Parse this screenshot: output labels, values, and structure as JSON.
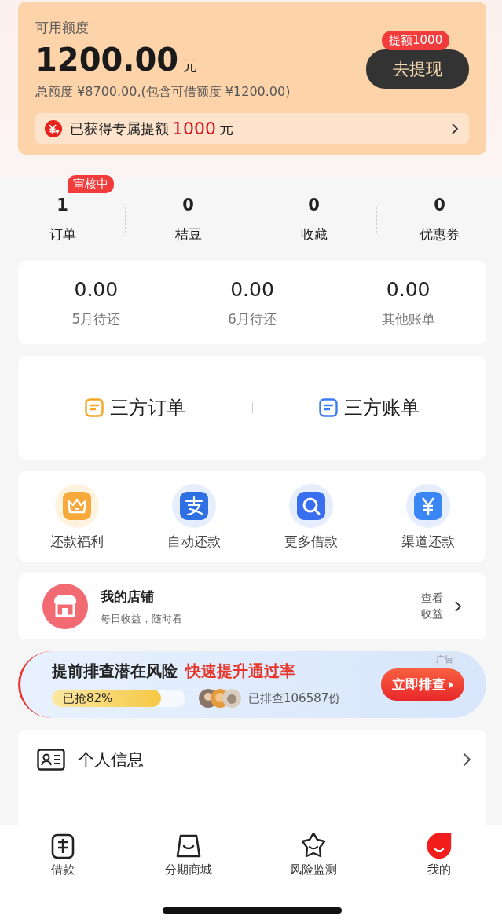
{
  "credit": {
    "label": "可用额度",
    "amount": "1200.00",
    "unit": "元",
    "total": "总额度 ¥8700.00,(包含可借额度 ¥1200.00)",
    "badge": "提额1000",
    "button": "去提现",
    "bonus": {
      "text": "已获得专属提额",
      "amount": "1000",
      "unit": "元"
    }
  },
  "stats": [
    {
      "value": "1",
      "label": "订单",
      "badge": "审核中"
    },
    {
      "value": "0",
      "label": "桔豆"
    },
    {
      "value": "0",
      "label": "收藏"
    },
    {
      "value": "0",
      "label": "优惠券"
    }
  ],
  "bills": [
    {
      "amount": "0.00",
      "label": "5月待还"
    },
    {
      "amount": "0.00",
      "label": "6月待还"
    },
    {
      "amount": "0.00",
      "label": "其他账单"
    }
  ],
  "third_party": [
    {
      "label": "三方订单",
      "color": "#f5a623"
    },
    {
      "label": "三方账单",
      "color": "#3d7bf5"
    }
  ],
  "services": [
    {
      "label": "还款福利",
      "kind": "crown"
    },
    {
      "label": "自动还款",
      "kind": "alipay"
    },
    {
      "label": "更多借款",
      "kind": "search"
    },
    {
      "label": "渠道还款",
      "kind": "yuan"
    }
  ],
  "shop": {
    "title": "我的店铺",
    "subtitle": "每日收益，随时看",
    "action": "查看收益"
  },
  "banner": {
    "title": "提前排查潜在风险",
    "highlight": "快速提升通过率",
    "ad": "广告",
    "progress": {
      "label": "已抢82%",
      "level": 0.82
    },
    "count": "已排查106587份",
    "button": "立即排查"
  },
  "menu": [
    {
      "label": "个人信息",
      "kind": "id-card"
    }
  ],
  "tabs": [
    {
      "label": "借款",
      "kind": "loan",
      "selected": false
    },
    {
      "label": "分期商城",
      "kind": "bag",
      "selected": false
    },
    {
      "label": "风险监测",
      "kind": "star",
      "selected": false
    },
    {
      "label": "我的",
      "kind": "me",
      "selected": true
    }
  ]
}
